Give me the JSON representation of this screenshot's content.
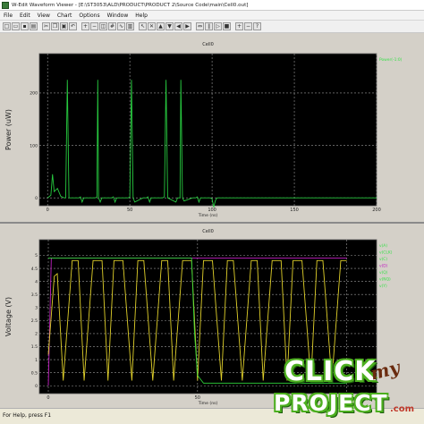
{
  "window": {
    "title": "W-Edit Waveform Viewer - [E:\\ST3053\\ALD\\PRODUCT\\PRODUCT 2\\Source Code\\main\\Cell0.out]"
  },
  "menu": [
    "File",
    "Edit",
    "View",
    "Chart",
    "Options",
    "Window",
    "Help"
  ],
  "toolbar": {
    "icons": [
      "new-icon",
      "open-icon",
      "save-icon",
      "print-icon",
      "cut-icon",
      "copy-icon",
      "paste-icon",
      "undo-icon",
      "zoom-in-icon",
      "zoom-out-icon",
      "zoom-fit-icon",
      "grid-icon",
      "trace-icon",
      "chart-icon",
      "cursor-icon",
      "cross-icon",
      "up-icon",
      "down-icon",
      "left-icon",
      "right-icon",
      "expand-icon",
      "pause-icon",
      "play-icon",
      "stop-icon",
      "plus-icon",
      "minus-icon",
      "help-icon"
    ]
  },
  "colors": {
    "plot_bg": "#000000",
    "grid": "#9a9a9a",
    "power_trace": "#27c93f",
    "output_trace": "#e0d02a",
    "input_trace": "#c21fc2",
    "bottom_trace": "#2fd63a",
    "legend_text": "#39e04a"
  },
  "chart_data": [
    {
      "type": "line",
      "title": "Cell0",
      "ylabel": "Power (uW)",
      "xlabel": "Time (ns)",
      "xlim": [
        -5,
        200
      ],
      "ylim": [
        -15,
        275
      ],
      "xticks": [
        0,
        50,
        100,
        150,
        200
      ],
      "yticks": [
        0,
        100,
        200
      ],
      "series": [
        {
          "name": "Power(-1:0)",
          "x": [
            0,
            2,
            3,
            4,
            6,
            8,
            10,
            11,
            12,
            13,
            19,
            20,
            21,
            22,
            23,
            28,
            29,
            30,
            30.5,
            31,
            32,
            33,
            38,
            39,
            40,
            41,
            42,
            43,
            48,
            49,
            50,
            51,
            52,
            53,
            58,
            59,
            60,
            61,
            62,
            63,
            68,
            69,
            70,
            71,
            72,
            73,
            78,
            79,
            80,
            80.5,
            81,
            82,
            83,
            88,
            89,
            90,
            91,
            92,
            93,
            98,
            99,
            100,
            101,
            102,
            103,
            105,
            110,
            130,
            150,
            200
          ],
          "y": [
            0,
            5,
            45,
            12,
            18,
            3,
            0,
            0,
            225,
            0,
            0,
            2,
            -8,
            0,
            0,
            0,
            0,
            2,
            225,
            0,
            -8,
            0,
            0,
            0,
            2,
            -8,
            0,
            0,
            0,
            0,
            2,
            225,
            0,
            -8,
            0,
            0,
            0,
            2,
            -8,
            0,
            0,
            0,
            0,
            2,
            225,
            0,
            -8,
            0,
            0,
            0,
            225,
            0,
            -6,
            0,
            0,
            0,
            2,
            -8,
            0,
            0,
            0,
            -2,
            -18,
            -5,
            0,
            0,
            0,
            0,
            0,
            0
          ]
        }
      ]
    },
    {
      "type": "line",
      "title": "Cell0",
      "ylabel": "Voltage (V)",
      "xlabel": "Time (ns)",
      "xlim": [
        -3,
        110
      ],
      "ylim": [
        -0.3,
        5.6
      ],
      "xticks": [
        0,
        50,
        100
      ],
      "yticks": [
        0,
        0.5,
        1,
        1.5,
        2,
        2.5,
        3,
        3.5,
        4,
        4.5,
        5
      ],
      "legend": [
        "v(A)",
        "v(CLK)",
        "v(C)",
        "v(D)",
        "v(Q)",
        "v(NQ)",
        "v(Y)"
      ],
      "series": [
        {
          "name": "v(A)",
          "x": [
            0,
            1,
            2,
            100
          ],
          "y": [
            0,
            4.9,
            4.9,
            4.9
          ]
        },
        {
          "name": "v(CLK)",
          "x": [
            0,
            2,
            3,
            5,
            8,
            10,
            12,
            15,
            18,
            20,
            22,
            25,
            28,
            30,
            32,
            35,
            38,
            40,
            42,
            45,
            48,
            50,
            52,
            55,
            58,
            60,
            62,
            65,
            68,
            70,
            72,
            75,
            78,
            80,
            82,
            85,
            88,
            90,
            92,
            95,
            98,
            100
          ],
          "y": [
            1.2,
            4.2,
            4.3,
            0.2,
            4.8,
            4.8,
            0.2,
            4.8,
            4.8,
            0.2,
            4.8,
            4.8,
            0.2,
            4.8,
            4.8,
            0.2,
            4.8,
            4.8,
            0.2,
            4.8,
            4.8,
            0.2,
            4.8,
            4.8,
            0.2,
            4.8,
            4.8,
            0.2,
            4.8,
            4.8,
            0.2,
            4.8,
            4.8,
            0.2,
            4.8,
            4.8,
            0.2,
            4.8,
            4.8,
            0.2,
            4.8,
            4.8
          ]
        },
        {
          "name": "v(Y)",
          "x": [
            0,
            48,
            49,
            50,
            52,
            100
          ],
          "y": [
            4.9,
            4.9,
            2.0,
            0.4,
            0.1,
            0.1
          ]
        }
      ]
    }
  ],
  "status": {
    "message": "For Help, press F1"
  },
  "watermark": {
    "line1": "CLICK",
    "line2": "my",
    "line3": "PROJECT",
    "domain": ".com"
  }
}
